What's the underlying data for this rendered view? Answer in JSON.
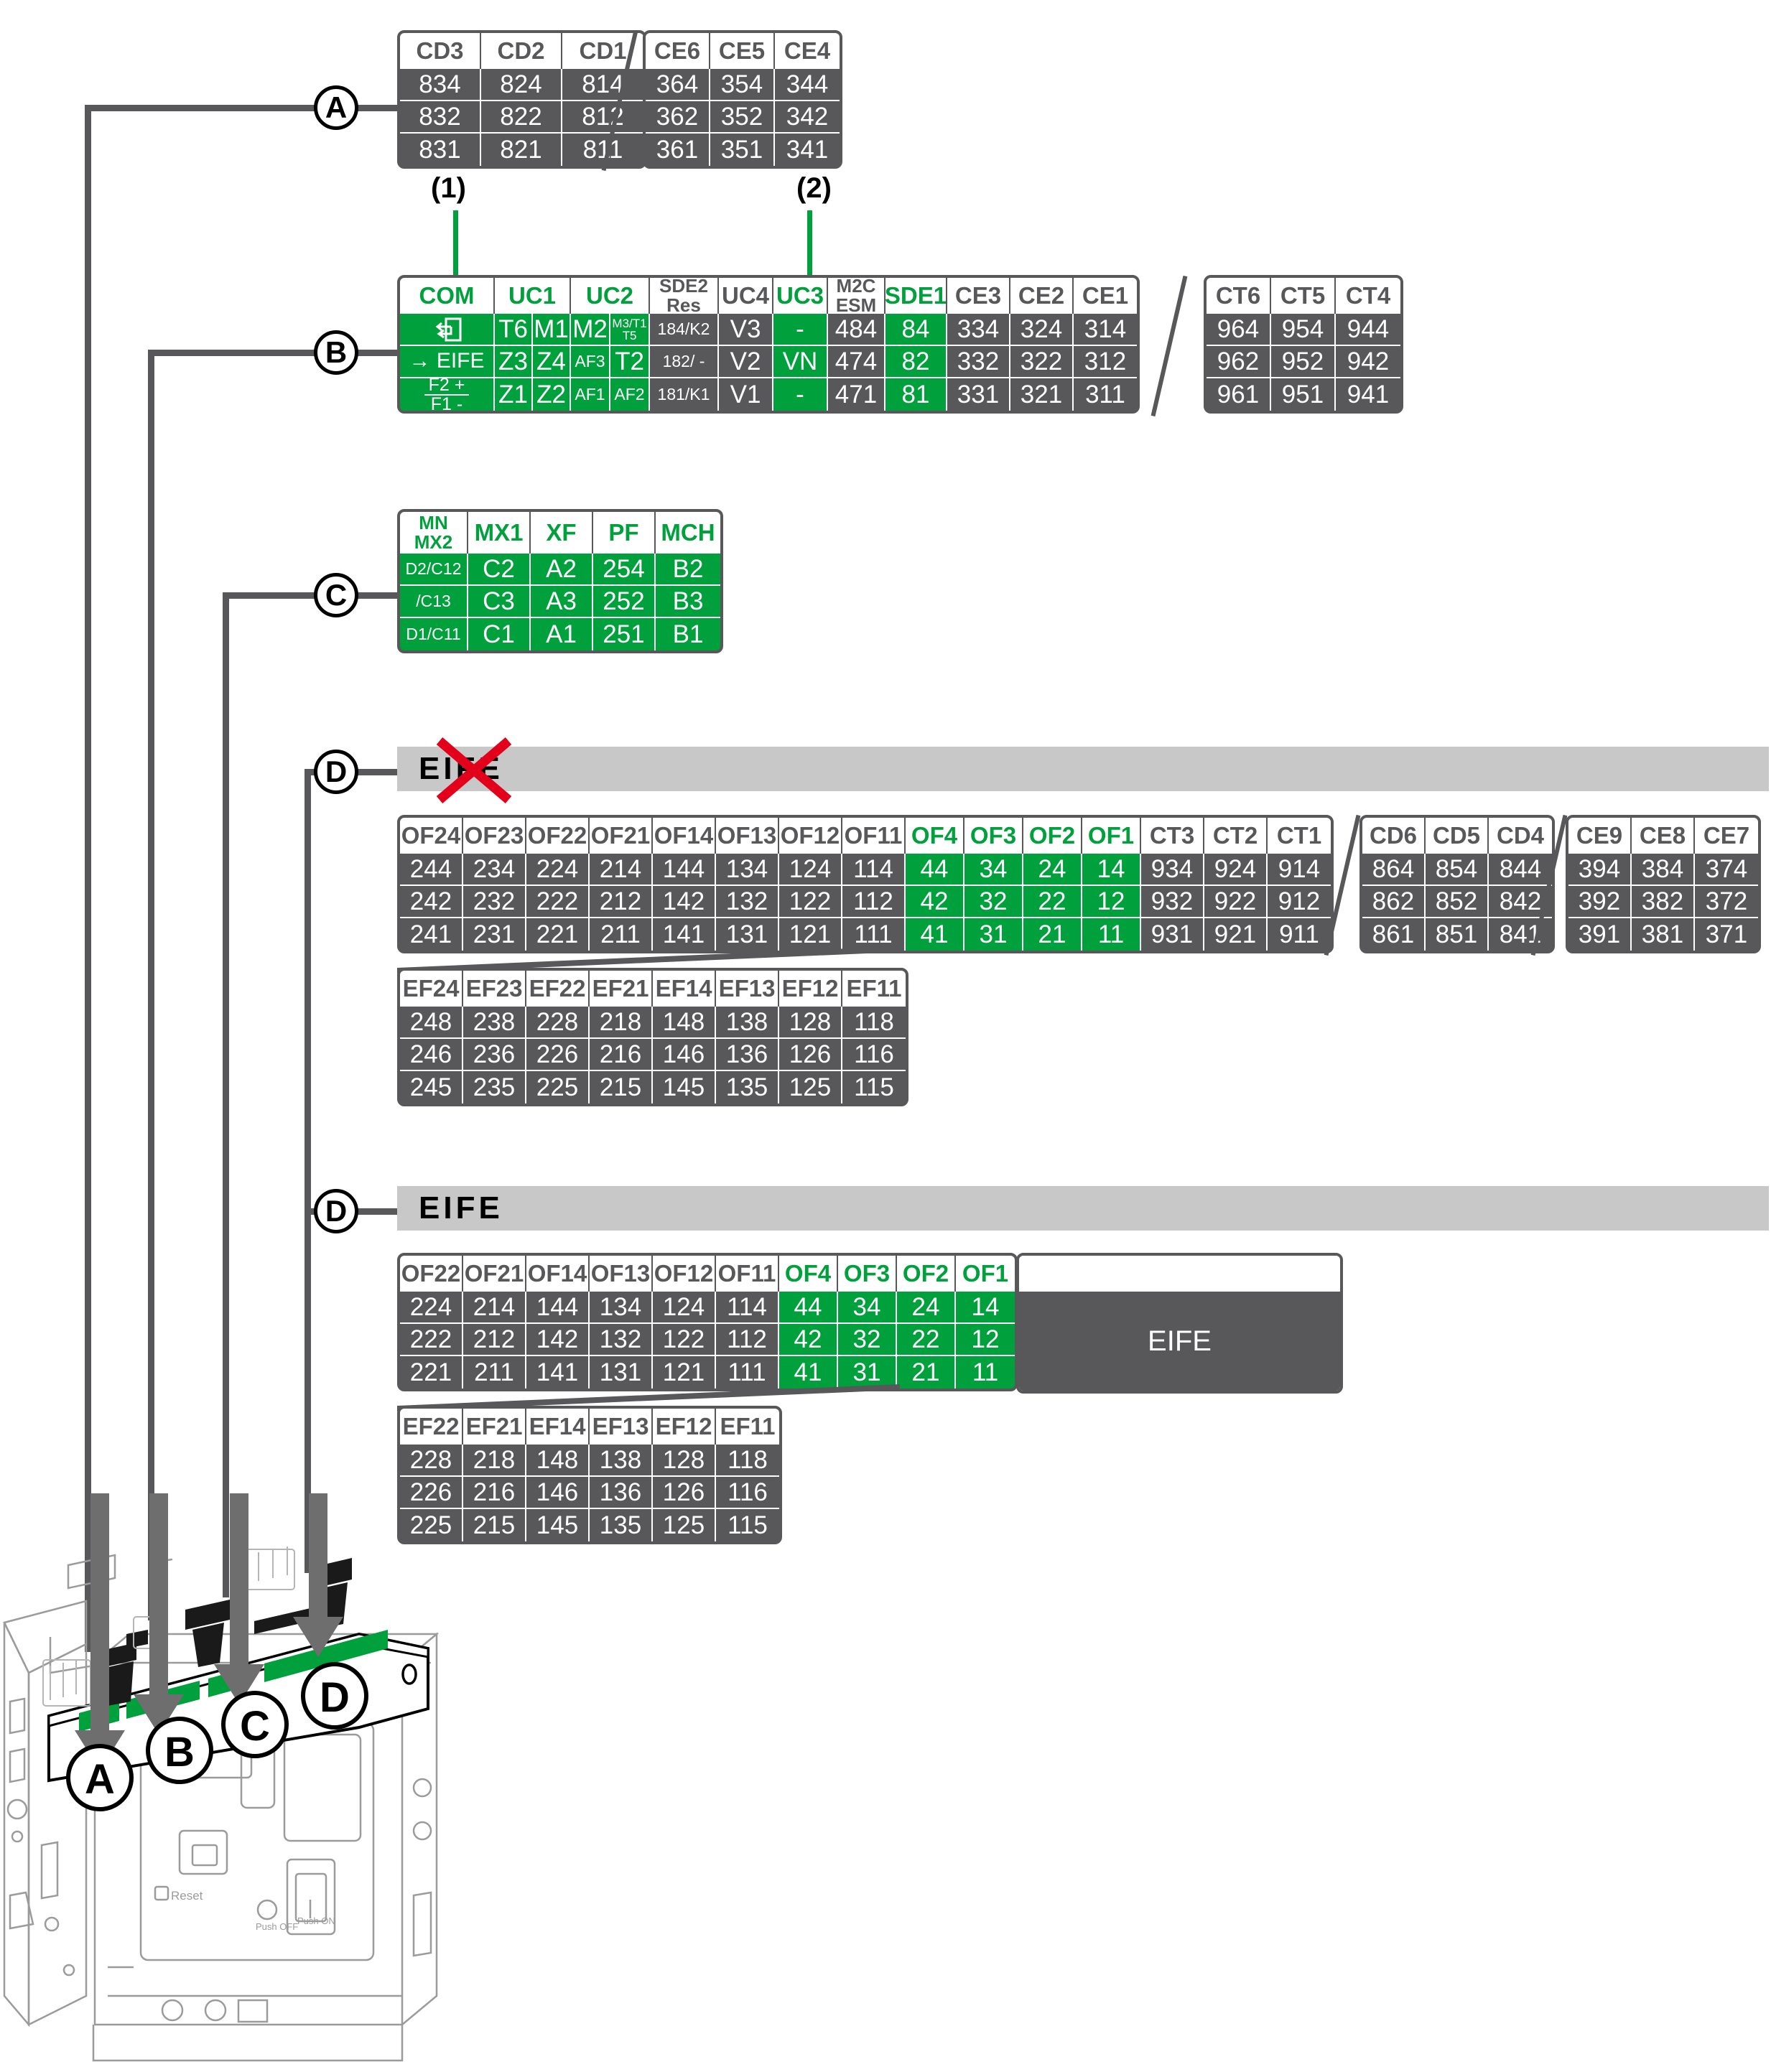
{
  "meta": {
    "callout_a": "A",
    "callout_b": "B",
    "callout_c": "C",
    "callout_d": "D",
    "note_1": "(1)",
    "note_2": "(2)",
    "accent_green": "#00a03c",
    "dark_grey": "#58585a",
    "bar_grey": "#c8c8c8",
    "red": "#e2001a"
  },
  "section_a": {
    "table_cd": {
      "headers": [
        "CD3",
        "CD2",
        "CD1"
      ],
      "rows": [
        [
          "834",
          "824",
          "814"
        ],
        [
          "832",
          "822",
          "812"
        ],
        [
          "831",
          "821",
          "811"
        ]
      ]
    },
    "table_ce": {
      "headers": [
        "CE6",
        "CE5",
        "CE4"
      ],
      "rows": [
        [
          "364",
          "354",
          "344"
        ],
        [
          "362",
          "352",
          "342"
        ],
        [
          "361",
          "351",
          "341"
        ]
      ]
    }
  },
  "section_b": {
    "main_table": {
      "headers": [
        {
          "label": "COM",
          "green": true,
          "span": 1
        },
        {
          "label": "UC1",
          "green": true,
          "span": 2
        },
        {
          "label": "UC2",
          "green": true,
          "span": 2
        },
        {
          "label": "SDE2\nRes",
          "green": false,
          "span": 1
        },
        {
          "label": "UC4",
          "green": false,
          "span": 1
        },
        {
          "label": "UC3",
          "green": true,
          "span": 1
        },
        {
          "label": "M2C\nESM",
          "green": false,
          "span": 1
        },
        {
          "label": "SDE1",
          "green": true,
          "span": 1
        },
        {
          "label": "CE3",
          "green": false,
          "span": 1
        },
        {
          "label": "CE2",
          "green": false,
          "span": 1
        },
        {
          "label": "CE1",
          "green": false,
          "span": 1
        }
      ],
      "header_labels_flat": [
        "COM",
        "UC1",
        "UC2",
        "SDE2 Res",
        "UC4",
        "UC3",
        "M2C ESM",
        "SDE1",
        "CE3",
        "CE2",
        "CE1"
      ],
      "row1": {
        "com": "return-arrow-icon",
        "uc1a": "T6",
        "uc1b": "M1",
        "uc2a": "M2",
        "uc2b": "M3/T1 T5",
        "sde2": "184/K2",
        "uc4": "V3",
        "uc3": "-",
        "m2c": "484",
        "sde1": "84",
        "ce3": "334",
        "ce2": "324",
        "ce1": "314"
      },
      "row2": {
        "com": "→ EIFE",
        "uc1a": "Z3",
        "uc1b": "Z4",
        "uc2a": "AF3",
        "uc2b": "T2",
        "sde2": "182/ -",
        "uc4": "V2",
        "uc3": "VN",
        "m2c": "474",
        "sde1": "82",
        "ce3": "332",
        "ce2": "322",
        "ce1": "312"
      },
      "row3": {
        "com_top": "F2 +",
        "com_bot": "F1 -",
        "uc1a": "Z1",
        "uc1b": "Z2",
        "uc2a": "AF1",
        "uc2b": "AF2",
        "sde2": "181/K1",
        "uc4": "V1",
        "uc3": "-",
        "m2c": "471",
        "sde1": "81",
        "ce3": "331",
        "ce2": "321",
        "ce1": "311"
      }
    },
    "table_ct": {
      "headers": [
        "CT6",
        "CT5",
        "CT4"
      ],
      "rows": [
        [
          "964",
          "954",
          "944"
        ],
        [
          "962",
          "952",
          "942"
        ],
        [
          "961",
          "951",
          "941"
        ]
      ]
    }
  },
  "section_c": {
    "table": {
      "headers": [
        "MN MX2",
        "MX1",
        "XF",
        "PF",
        "MCH"
      ],
      "header_first_top": "MN",
      "header_first_bot": "MX2",
      "rows": [
        [
          "D2/C12",
          "C2",
          "A2",
          "254",
          "B2"
        ],
        [
          "/C13",
          "C3",
          "A3",
          "252",
          "B3"
        ],
        [
          "D1/C11",
          "C1",
          "A1",
          "251",
          "B1"
        ]
      ]
    }
  },
  "section_d1": {
    "bar_label": "EIFE",
    "crossed_out": true,
    "table_of": {
      "headers": [
        "OF24",
        "OF23",
        "OF22",
        "OF21",
        "OF14",
        "OF13",
        "OF12",
        "OF11",
        "OF4",
        "OF3",
        "OF2",
        "OF1",
        "CT3",
        "CT2",
        "CT1"
      ],
      "green_cols": [
        8,
        9,
        10,
        11
      ],
      "rows": [
        [
          "244",
          "234",
          "224",
          "214",
          "144",
          "134",
          "124",
          "114",
          "44",
          "34",
          "24",
          "14",
          "934",
          "924",
          "914"
        ],
        [
          "242",
          "232",
          "222",
          "212",
          "142",
          "132",
          "122",
          "112",
          "42",
          "32",
          "22",
          "12",
          "932",
          "922",
          "912"
        ],
        [
          "241",
          "231",
          "221",
          "211",
          "141",
          "131",
          "121",
          "111",
          "41",
          "31",
          "21",
          "11",
          "931",
          "921",
          "911"
        ]
      ]
    },
    "table_cd": {
      "headers": [
        "CD6",
        "CD5",
        "CD4"
      ],
      "rows": [
        [
          "864",
          "854",
          "844"
        ],
        [
          "862",
          "852",
          "842"
        ],
        [
          "861",
          "851",
          "841"
        ]
      ]
    },
    "table_ce": {
      "headers": [
        "CE9",
        "CE8",
        "CE7"
      ],
      "rows": [
        [
          "394",
          "384",
          "374"
        ],
        [
          "392",
          "382",
          "372"
        ],
        [
          "391",
          "381",
          "371"
        ]
      ]
    },
    "table_ef": {
      "headers": [
        "EF24",
        "EF23",
        "EF22",
        "EF21",
        "EF14",
        "EF13",
        "EF12",
        "EF11"
      ],
      "rows": [
        [
          "248",
          "238",
          "228",
          "218",
          "148",
          "138",
          "128",
          "118"
        ],
        [
          "246",
          "236",
          "226",
          "216",
          "146",
          "136",
          "126",
          "116"
        ],
        [
          "245",
          "235",
          "225",
          "215",
          "145",
          "135",
          "125",
          "115"
        ]
      ]
    }
  },
  "section_d2": {
    "bar_label": "EIFE",
    "crossed_out": false,
    "table_of": {
      "headers": [
        "OF22",
        "OF21",
        "OF14",
        "OF13",
        "OF12",
        "OF11",
        "OF4",
        "OF3",
        "OF2",
        "OF1"
      ],
      "green_cols": [
        6,
        7,
        8,
        9
      ],
      "rows": [
        [
          "224",
          "214",
          "144",
          "134",
          "124",
          "114",
          "44",
          "34",
          "24",
          "14"
        ],
        [
          "222",
          "212",
          "142",
          "132",
          "122",
          "112",
          "42",
          "32",
          "22",
          "12"
        ],
        [
          "221",
          "211",
          "141",
          "131",
          "121",
          "111",
          "41",
          "31",
          "21",
          "11"
        ]
      ]
    },
    "eife_block_label": "EIFE",
    "table_ef": {
      "headers": [
        "EF22",
        "EF21",
        "EF14",
        "EF13",
        "EF12",
        "EF11"
      ],
      "rows": [
        [
          "228",
          "218",
          "148",
          "138",
          "128",
          "118"
        ],
        [
          "226",
          "216",
          "146",
          "136",
          "126",
          "116"
        ],
        [
          "225",
          "215",
          "145",
          "135",
          "125",
          "115"
        ]
      ]
    }
  },
  "device": {
    "markers": [
      "A",
      "B",
      "C",
      "D"
    ],
    "reset_label": "Reset",
    "push_off_label": "Push OFF",
    "push_on_label": "Push ON"
  }
}
